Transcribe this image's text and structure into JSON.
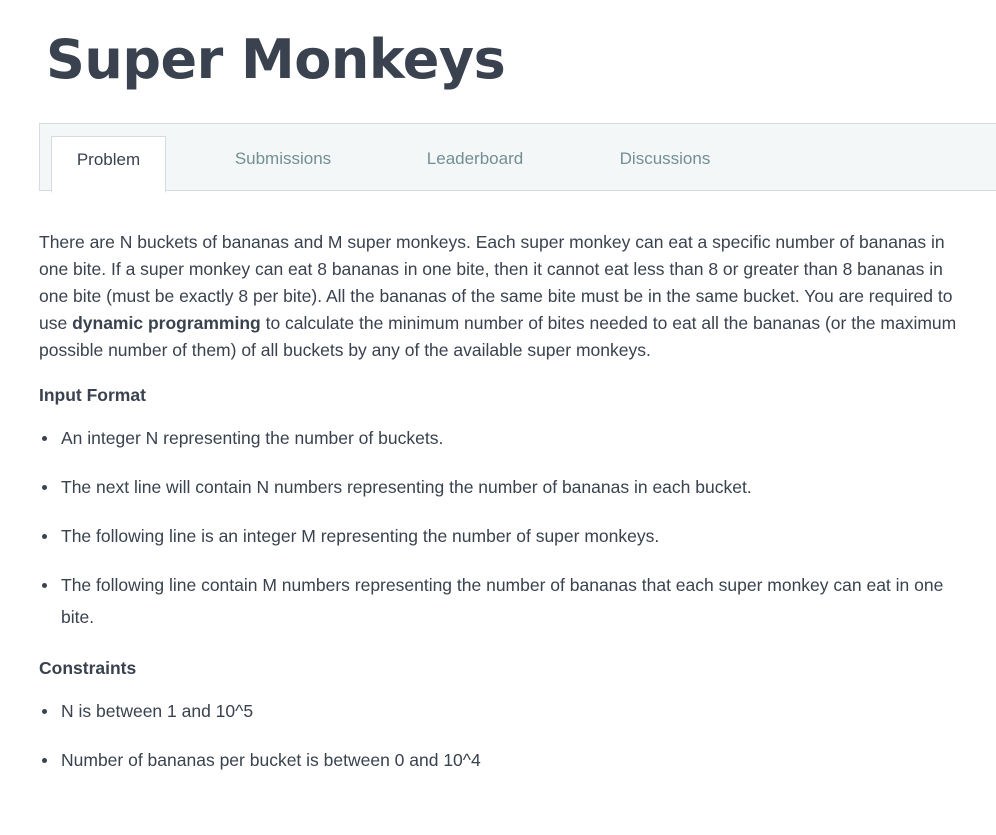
{
  "title": "Super Monkeys",
  "tabs": [
    {
      "label": "Problem"
    },
    {
      "label": "Submissions"
    },
    {
      "label": "Leaderboard"
    },
    {
      "label": "Discussions"
    }
  ],
  "description": {
    "before": "There are N buckets of bananas and M super monkeys. Each super monkey can eat a specific number of bananas in one bite. If a super monkey can eat 8 bananas in one bite, then it cannot eat less than 8 or greater than 8 bananas in one bite (must be exactly 8 per bite). All the bananas of the same bite must be in the same bucket. You are required to use ",
    "bold": "dynamic programming",
    "after": " to calculate the minimum number of bites needed to eat all the bananas (or the maximum possible number of them) of all buckets by any of the available super monkeys."
  },
  "input_format": {
    "heading": "Input Format",
    "items": [
      "An integer N representing the number of buckets.",
      "The next line will contain N numbers representing the number of bananas in each bucket.",
      "The following line is an integer M representing the number of super monkeys.",
      "The following line contain M numbers representing the number of bananas that each super monkey can eat in one bite."
    ]
  },
  "constraints": {
    "heading": "Constraints",
    "items": [
      "N is between 1 and 10^5",
      "Number of bananas per bucket is between 0 and 10^4"
    ]
  }
}
